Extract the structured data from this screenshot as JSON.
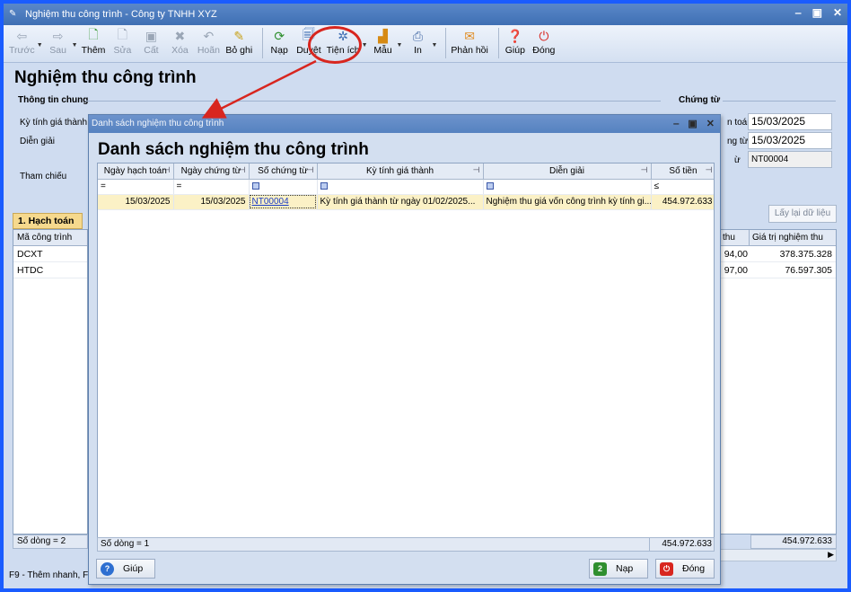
{
  "window": {
    "title": "Nghiệm thu công trình - Công ty TNHH XYZ"
  },
  "toolbar": {
    "items": [
      {
        "label": "Trước",
        "icon": "arrow-left-icon"
      },
      {
        "label": "Sau",
        "icon": "arrow-right-icon"
      },
      {
        "label": "Thêm",
        "icon": "add-document-icon"
      },
      {
        "label": "Sửa",
        "icon": "edit-icon"
      },
      {
        "label": "Cất",
        "icon": "save-icon"
      },
      {
        "label": "Xóa",
        "icon": "delete-icon"
      },
      {
        "label": "Hoãn",
        "icon": "undo-icon"
      },
      {
        "label": "Bỏ ghi",
        "icon": "unpost-icon"
      },
      {
        "label": "Nạp",
        "icon": "refresh-icon"
      },
      {
        "label": "Duyệt",
        "icon": "browse-icon"
      },
      {
        "label": "Tiện ích",
        "icon": "utilities-icon"
      },
      {
        "label": "Mẫu",
        "icon": "template-icon"
      },
      {
        "label": "In",
        "icon": "print-icon"
      },
      {
        "label": "Phản hồi",
        "icon": "feedback-icon"
      },
      {
        "label": "Giúp",
        "icon": "help-icon"
      },
      {
        "label": "Đóng",
        "icon": "close-icon"
      }
    ]
  },
  "form": {
    "heading": "Nghiệm thu công trình",
    "general_section": "Thông tin chung",
    "voucher_section": "Chứng từ",
    "period_label": "Kỳ tính giá thành",
    "description_label": "Diễn giải",
    "reference_label": "Tham chiếu",
    "posting_date_label_partial": "n toán",
    "voucher_date_label_partial": "ng từ",
    "voucher_no_label_partial": "ừ",
    "posting_date": "15/03/2025",
    "voucher_date": "15/03/2025",
    "voucher_no": "NT00004",
    "reload_button": "Lấy lại dữ liệu",
    "tab_label": "1. Hạch toán",
    "grid_col_code": "Mã công trình",
    "grid_col_partial": "thu",
    "grid_col_value": "Giá trị nghiệm thu",
    "rows": [
      {
        "code": "DCXT",
        "partial": "94,00",
        "value": "378.375.328"
      },
      {
        "code": "HTDC",
        "partial": "97,00",
        "value": "76.597.305"
      }
    ],
    "row_count": "Số dòng = 2",
    "total": "454.972.633",
    "status_hint": "F9 - Thêm nhanh, F3"
  },
  "dialog": {
    "title": "Danh sách nghiệm thu công trình",
    "heading": "Danh sách nghiệm thu công trình",
    "columns": [
      "Ngày hạch toán",
      "Ngày chứng từ",
      "Số chứng từ",
      "Kỳ tính giá thành",
      "Diễn giải",
      "Số tiền"
    ],
    "filter_ops": [
      "=",
      "=",
      "■",
      "■",
      "■",
      "≤"
    ],
    "rows": [
      {
        "posting_date": "15/03/2025",
        "voucher_date": "15/03/2025",
        "voucher_no": "NT00004",
        "period": "Kỳ tính giá thành từ ngày 01/02/2025...",
        "description": "Nghiệm thu giá vốn công trình kỳ tính gi...",
        "amount": "454.972.633"
      }
    ],
    "row_count": "Số dòng = 1",
    "total": "454.972.633",
    "help_button": "Giúp",
    "load_button": "Nạp",
    "close_button": "Đóng"
  }
}
